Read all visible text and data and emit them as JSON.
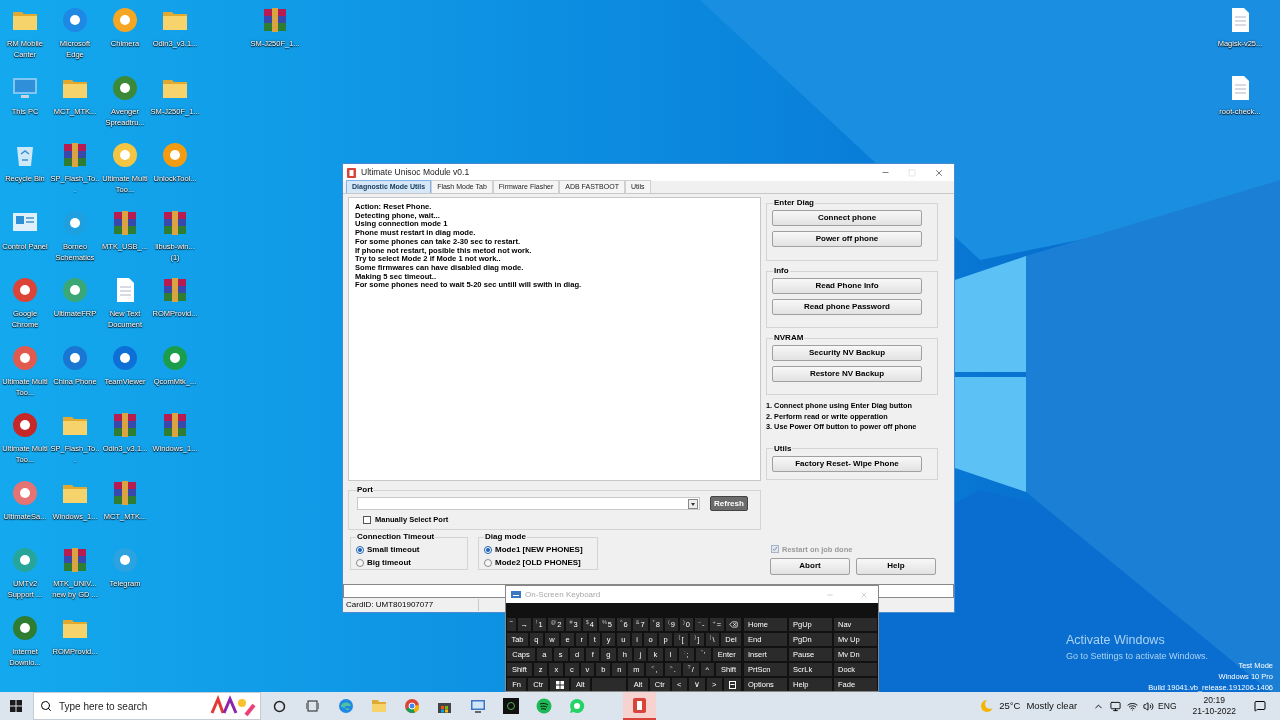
{
  "desktop": {
    "icon_columns": [
      [
        {
          "kind": "folder",
          "label": "RM Mobile Canter"
        },
        {
          "kind": "pc",
          "label": "This PC"
        },
        {
          "kind": "bin",
          "label": "Recycle Bin"
        },
        {
          "kind": "panel",
          "label": "Control Panel"
        },
        {
          "kind": "app",
          "color": "#db4437",
          "label": "Google Chrome"
        },
        {
          "kind": "app",
          "color": "#e05a4f",
          "label": "Ultimate Multi Too..."
        },
        {
          "kind": "app",
          "color": "#c62828",
          "label": "Ultimate Multi Too..."
        },
        {
          "kind": "app",
          "color": "#e57373",
          "label": "UltimateSa..."
        },
        {
          "kind": "app",
          "color": "#26a69a",
          "label": "UMTv2 Support ..."
        },
        {
          "kind": "app",
          "color": "#2e7d32",
          "label": "Internet Downlo..."
        }
      ],
      [
        {
          "kind": "app",
          "color": "#1e88e5",
          "label": "Microsoft Edge"
        },
        {
          "kind": "folder",
          "label": "MCT_MTK..."
        },
        {
          "kind": "archive",
          "label": "SP_Flash_To..."
        },
        {
          "kind": "app",
          "color": "#1ea0e0",
          "label": "Borneo Schematics"
        },
        {
          "kind": "app",
          "color": "#3aa876",
          "label": "UltimateFRP"
        },
        {
          "kind": "app",
          "color": "#1976d2",
          "label": "China Phone"
        },
        {
          "kind": "folder",
          "label": "SP_Flash_To..."
        },
        {
          "kind": "folder",
          "label": "Windows_1..."
        },
        {
          "kind": "archive",
          "label": "MTK_UNIV... new by GD ..."
        },
        {
          "kind": "folder",
          "label": "ROMProvid..."
        }
      ],
      [
        {
          "kind": "app",
          "color": "#f5a623",
          "label": "Chimera"
        },
        {
          "kind": "app",
          "color": "#3a8a3a",
          "label": "Avenger Spreadtru..."
        },
        {
          "kind": "app",
          "color": "#f4c542",
          "label": "Ultimate Multi Too..."
        },
        {
          "kind": "archive",
          "label": "MTK_USB_..."
        },
        {
          "kind": "document",
          "label": "New Text Document"
        },
        {
          "kind": "app",
          "color": "#0e6fd6",
          "label": "TeamViewer"
        },
        {
          "kind": "archive",
          "label": "Odin3_v3.1..."
        },
        {
          "kind": "archive",
          "label": "MCT_MTK..."
        },
        {
          "kind": "app",
          "color": "#2aa3e0",
          "label": "Telegram"
        }
      ],
      [
        {
          "kind": "folder",
          "label": "Odin3_v3.1..."
        },
        {
          "kind": "folder",
          "label": "SM-J250F_1..."
        },
        {
          "kind": "app",
          "color": "#f39c12",
          "label": "UnlockTool..."
        },
        {
          "kind": "archive",
          "label": "libusb-win... (1)"
        },
        {
          "kind": "archive",
          "label": "ROMProvid..."
        },
        {
          "kind": "app",
          "color": "#1b9e4b",
          "label": "QcomMtk_..."
        },
        {
          "kind": "archive",
          "label": "Windows_1..."
        }
      ]
    ],
    "extra_column": [
      {
        "kind": "archive",
        "label": "SM-J250F_1..."
      }
    ],
    "right_column": [
      {
        "kind": "document",
        "label": "Magisk-v25..."
      },
      {
        "kind": "document",
        "label": "root-check..."
      }
    ],
    "activation": {
      "title": "Activate Windows",
      "subtitle": "Go to Settings to activate Windows."
    },
    "build_info": [
      "Test Mode",
      "Windows 10 Pro",
      "Build 19041.vb_release.191206-1406"
    ]
  },
  "app_window": {
    "title": "Ultimate Unisoc Module v0.1",
    "tabs": [
      {
        "label": "Diagnostic  Mode Utils",
        "selected": true
      },
      {
        "label": "Flash Mode Tab",
        "selected": false
      },
      {
        "label": "Firmware Flasher",
        "selected": false
      },
      {
        "label": "ADB FASTBOOT",
        "selected": false
      },
      {
        "label": "Utils",
        "selected": false
      }
    ],
    "log_lines": [
      "Action: Reset Phone.",
      "Detecting phone, wait...",
      "Using connection mode 1",
      "Phone must restart in diag mode.",
      "For some phones can take 2-30 sec to restart.",
      "If phone not restart, posible this metod not work.",
      "Try to select Mode 2 if Mode 1 not work..",
      "Some firmwares can have disabled diag mode.",
      "Making 5 sec timeout..",
      "For some phones need to wait 5-20 sec untill will swith in diag."
    ],
    "groups": [
      {
        "title": "Enter Diag",
        "buttons": [
          "Connect phone",
          "Power off phone"
        ]
      },
      {
        "title": "Info",
        "buttons": [
          "Read Phone Info",
          "Read phone Password"
        ]
      },
      {
        "title": "NVRAM",
        "buttons": [
          "Security NV Backup",
          "Restore NV Backup"
        ]
      }
    ],
    "instructions": [
      "1. Connect phone using Enter Diag button",
      "2. Perform read or write opperation",
      "3. Use Power Off button to power off phone"
    ],
    "utils": {
      "title": "Utils",
      "buttons": [
        "Factory Reset- Wipe Phone"
      ]
    },
    "port": {
      "title": "Port",
      "refresh": "Refresh",
      "manual": {
        "label": "Manually Select Port",
        "checked": false
      }
    },
    "connection_timeout": {
      "title": "Connection Timeout",
      "options": [
        {
          "label": "Small timeout",
          "selected": true
        },
        {
          "label": "Big timeout",
          "selected": false
        }
      ]
    },
    "diag_mode": {
      "title": "Diag mode",
      "options": [
        {
          "label": "Mode1  [NEW PHONES]",
          "selected": true
        },
        {
          "label": "Mode2 [OLD PHONES]",
          "selected": false
        }
      ]
    },
    "restart": {
      "label": "Restart on job done",
      "checked": true,
      "disabled": true
    },
    "actions": [
      "Abort",
      "Help"
    ],
    "progress": {
      "level": 0
    },
    "status_bar": "CardID: UMT801907077"
  },
  "keyboard": {
    "title": "On-Screen Keyboard",
    "key_rows": [
      {
        "keys": [
          {
            "kind": "word",
            "label": "‾"
          },
          {
            "kind": "word",
            "label": "→"
          },
          {
            "kind": "char",
            "shift": "!",
            "label": "1"
          },
          {
            "kind": "char",
            "shift": "@",
            "label": "2"
          },
          {
            "kind": "char",
            "shift": "#",
            "label": "3"
          },
          {
            "kind": "char",
            "shift": "$",
            "label": "4"
          },
          {
            "kind": "char",
            "shift": "%",
            "label": "5"
          },
          {
            "kind": "char",
            "shift": "^",
            "label": "6"
          },
          {
            "kind": "char",
            "shift": "&",
            "label": "7"
          },
          {
            "kind": "char",
            "shift": "*",
            "label": "8"
          },
          {
            "kind": "char",
            "shift": "(",
            "label": "9"
          },
          {
            "kind": "char",
            "shift": ")",
            "label": "0"
          },
          {
            "kind": "char",
            "shift": "–",
            "label": "-"
          },
          {
            "kind": "char",
            "shift": "+",
            "label": "="
          },
          {
            "kind": "backspace"
          }
        ]
      },
      {
        "keys": [
          {
            "kind": "word",
            "label": "Tab"
          },
          {
            "kind": "char",
            "label": "q"
          },
          {
            "kind": "char",
            "label": "w"
          },
          {
            "kind": "char",
            "label": "e"
          },
          {
            "kind": "char",
            "label": "r"
          },
          {
            "kind": "char",
            "label": "t"
          },
          {
            "kind": "char",
            "label": "y"
          },
          {
            "kind": "char",
            "label": "u"
          },
          {
            "kind": "char",
            "label": "i"
          },
          {
            "kind": "char",
            "label": "o"
          },
          {
            "kind": "char",
            "label": "p"
          },
          {
            "kind": "char",
            "shift": "{",
            "label": "["
          },
          {
            "kind": "char",
            "shift": "}",
            "label": "]"
          },
          {
            "kind": "char",
            "shift": "|",
            "label": "\\"
          },
          {
            "kind": "word",
            "label": "Del"
          }
        ]
      },
      {
        "keys": [
          {
            "kind": "word",
            "label": "Caps"
          },
          {
            "kind": "char",
            "label": "a"
          },
          {
            "kind": "char",
            "label": "s"
          },
          {
            "kind": "char",
            "label": "d"
          },
          {
            "kind": "char",
            "label": "f"
          },
          {
            "kind": "char",
            "label": "g"
          },
          {
            "kind": "char",
            "label": "h"
          },
          {
            "kind": "char",
            "label": "j"
          },
          {
            "kind": "char",
            "label": "k"
          },
          {
            "kind": "char",
            "label": "l"
          },
          {
            "kind": "char",
            "shift": ":",
            "label": ";"
          },
          {
            "kind": "char",
            "shift": "\"",
            "label": "'"
          },
          {
            "kind": "word",
            "label": "Enter"
          }
        ]
      },
      {
        "keys": [
          {
            "kind": "word",
            "label": "Shift"
          },
          {
            "kind": "char",
            "label": "z"
          },
          {
            "kind": "char",
            "label": "x"
          },
          {
            "kind": "char",
            "label": "c"
          },
          {
            "kind": "char",
            "label": "v"
          },
          {
            "kind": "char",
            "label": "b"
          },
          {
            "kind": "char",
            "label": "n"
          },
          {
            "kind": "char",
            "label": "m"
          },
          {
            "kind": "char",
            "shift": "<",
            "label": ","
          },
          {
            "kind": "char",
            "shift": ">",
            "label": "."
          },
          {
            "kind": "char",
            "shift": "?",
            "label": "/"
          },
          {
            "kind": "word",
            "label": "^"
          },
          {
            "kind": "word",
            "label": "Shift"
          }
        ]
      },
      {
        "keys": [
          {
            "kind": "word",
            "label": "Fn"
          },
          {
            "kind": "word",
            "label": "Ctr"
          },
          {
            "kind": "windows"
          },
          {
            "kind": "word",
            "label": "Alt"
          },
          {
            "kind": "space"
          },
          {
            "kind": "word",
            "label": "Alt"
          },
          {
            "kind": "word",
            "label": "Ctr"
          },
          {
            "kind": "word",
            "label": "<"
          },
          {
            "kind": "word",
            "label": "∨"
          },
          {
            "kind": "word",
            "label": ">"
          },
          {
            "kind": "menu"
          }
        ]
      }
    ],
    "nav_keys": [
      "Home",
      "PgUp",
      "Nav",
      "End",
      "PgDn",
      "Mv Up",
      "Insert",
      "Pause",
      "Mv Dn",
      "PrtScn",
      "ScrLk",
      "Dock",
      "Options",
      "Help",
      "Fade"
    ]
  },
  "taskbar": {
    "search_placeholder": "Type here to search",
    "apps": [
      {
        "kind": "cortana",
        "active": false
      },
      {
        "kind": "taskview",
        "active": false
      },
      {
        "kind": "edge",
        "active": false
      },
      {
        "kind": "explorer",
        "active": false
      },
      {
        "kind": "chrome",
        "active": false
      },
      {
        "kind": "store",
        "active": false
      },
      {
        "kind": "remote",
        "active": false
      },
      {
        "kind": "terminal",
        "active": false
      },
      {
        "kind": "spotify",
        "active": false
      },
      {
        "kind": "whatsapp",
        "active": false
      },
      {
        "kind": "unisoc",
        "active": true
      }
    ],
    "weather": {
      "temp": "25°C",
      "text": "Mostly clear"
    },
    "language": "ENG",
    "time": "20:19",
    "date": "21-10-2022"
  }
}
